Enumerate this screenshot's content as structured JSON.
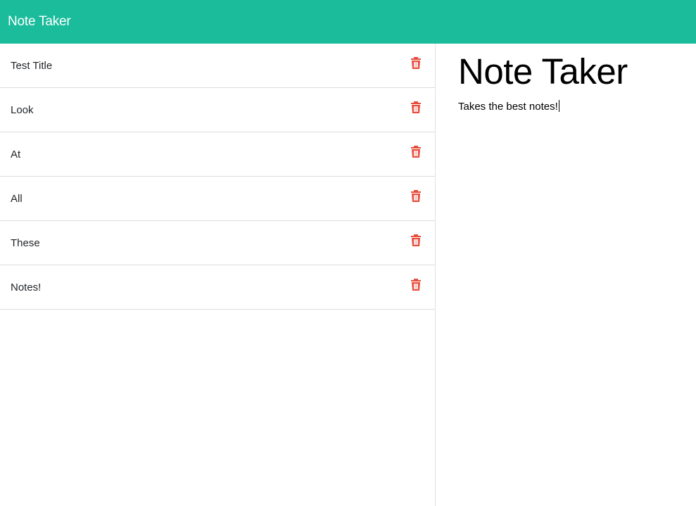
{
  "app": {
    "brand": "Note Taker"
  },
  "notes": [
    {
      "title": "Test Title"
    },
    {
      "title": "Look"
    },
    {
      "title": "At"
    },
    {
      "title": "All"
    },
    {
      "title": "These"
    },
    {
      "title": "Notes!"
    }
  ],
  "editor": {
    "title": "Note Taker",
    "text": "Takes the best notes!"
  },
  "colors": {
    "navbar": "#1abc9c",
    "delete_icon": "#e74c3c"
  },
  "icons": {
    "delete": "trash-icon"
  }
}
